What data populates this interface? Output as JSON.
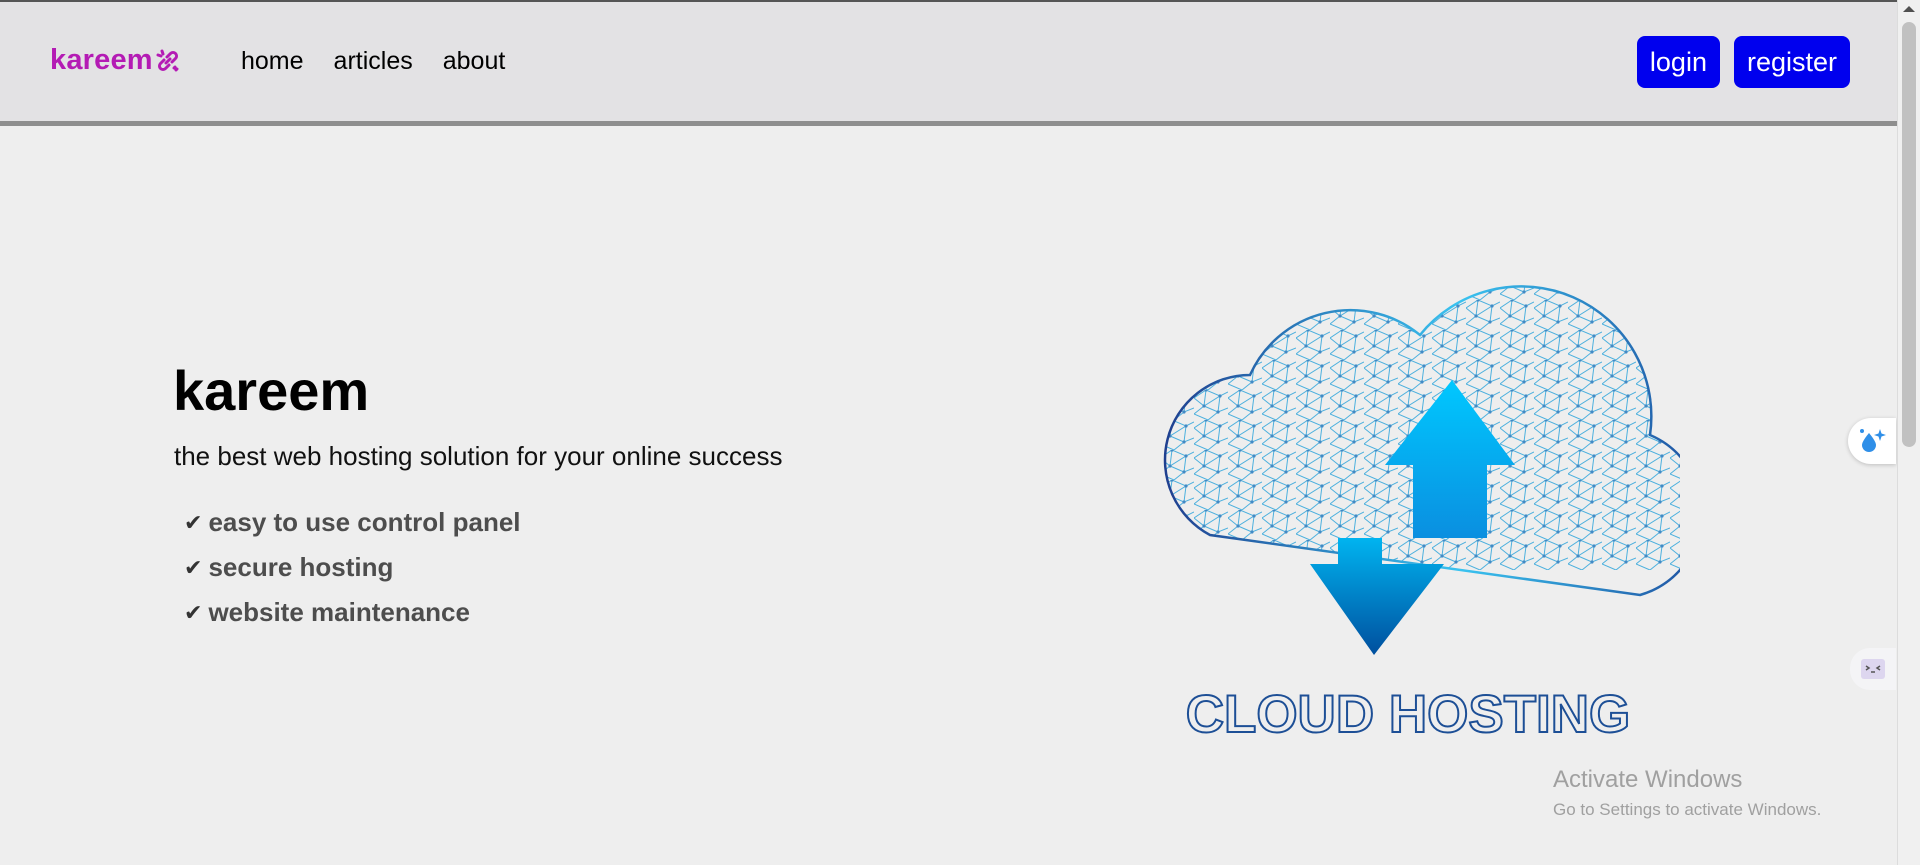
{
  "header": {
    "logo_text": "kareem",
    "logo_icon": "link-icon",
    "nav": [
      "home",
      "articles",
      "about"
    ],
    "login_label": "login",
    "register_label": "register"
  },
  "hero": {
    "title": "kareem",
    "subtitle": "the best web hosting solution for your online success",
    "check_icon": "✔",
    "features": [
      "easy to use control panel",
      "secure hosting",
      "website maintenance"
    ]
  },
  "illustration": {
    "caption": "CLOUD HOSTING"
  },
  "windows_notice": {
    "title": "Activate Windows",
    "subtitle": "Go to Settings to activate Windows."
  },
  "colors": {
    "logo": "#b41bb4",
    "button_bg": "#0000ee",
    "header_bg": "#e3e2e4",
    "page_bg": "#eeeeee",
    "arrow_light": "#00bfff",
    "arrow_dark": "#0058a8"
  }
}
